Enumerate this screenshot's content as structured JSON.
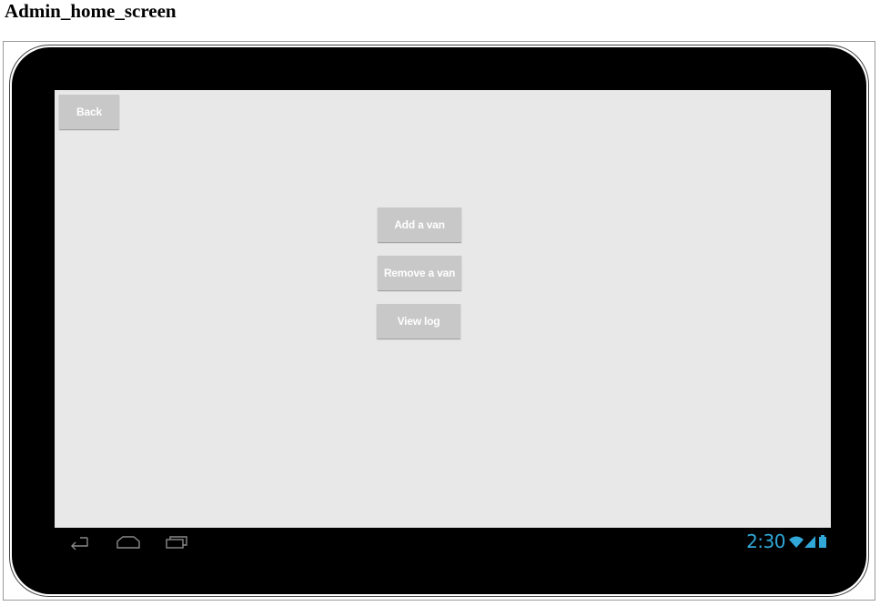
{
  "page": {
    "title": "Admin_home_screen"
  },
  "screen": {
    "back_label": "Back",
    "menu": {
      "add_van_label": "Add a van",
      "remove_van_label": "Remove a van",
      "view_log_label": "View log"
    }
  },
  "system_bar": {
    "clock": "2:30",
    "icons": [
      "back-icon",
      "home-icon",
      "recent-apps-icon",
      "wifi-icon",
      "signal-icon",
      "battery-icon"
    ],
    "accent_color": "#31a8d8"
  },
  "colors": {
    "screen_background": "#e8e8e8",
    "button_background": "#c8c8c8",
    "button_text": "#ffffff",
    "device_bezel": "#000000"
  }
}
